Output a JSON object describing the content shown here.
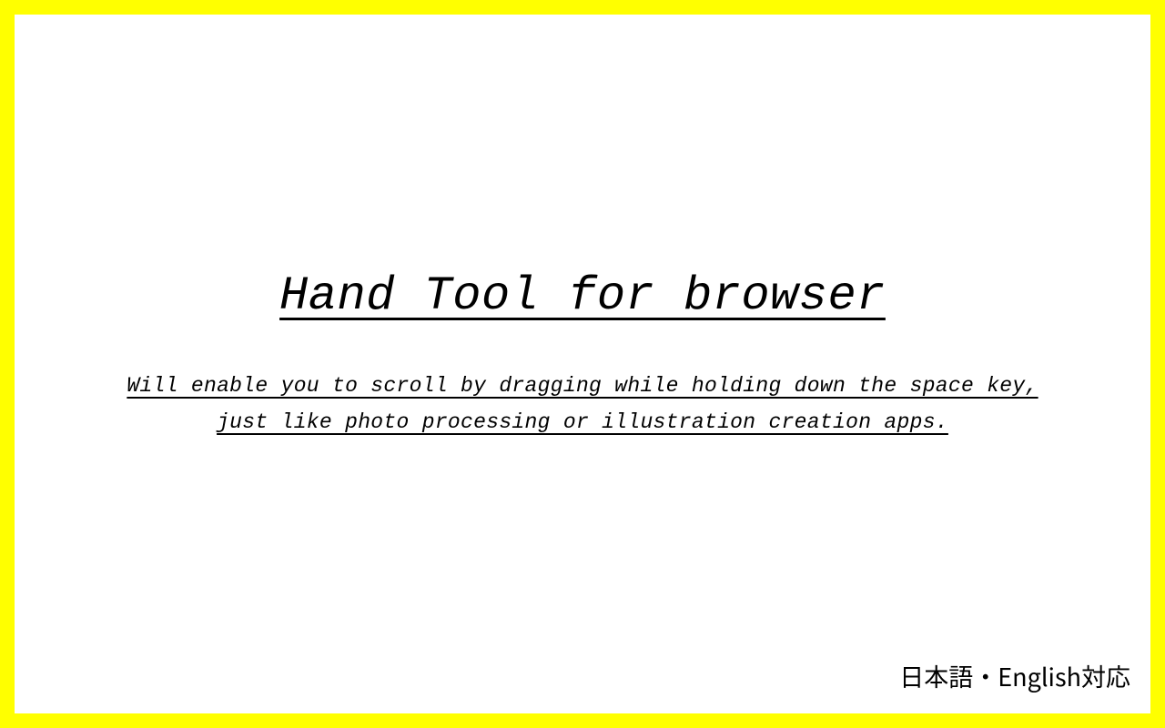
{
  "title": "Hand Tool for browser",
  "subtitle": "Will enable you to scroll by dragging while holding down the space key,\njust like photo processing or illustration creation apps.",
  "lang_note": "日本語・English対応"
}
